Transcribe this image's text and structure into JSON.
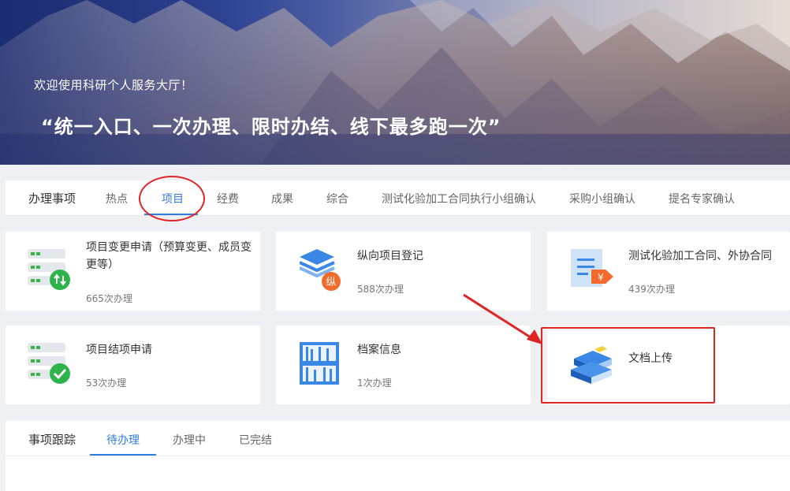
{
  "banner": {
    "welcome": "欢迎使用科研个人服务大厅！",
    "slogan": "“统一入口、一次办理、限时办结、线下最多跑一次”"
  },
  "tabs": {
    "title": "办理事项",
    "items": [
      "热点",
      "项目",
      "经费",
      "成果",
      "综合",
      "测试化验加工合同执行小组确认",
      "采购小组确认",
      "提名专家确认"
    ],
    "active": "项目"
  },
  "cards": [
    {
      "title_line1": "项目变更申请（预算变更、成员变",
      "title_line2": "更等）",
      "count": "665次办理",
      "icon": "server-update-icon"
    },
    {
      "title_line1": "纵向项目登记",
      "count": "588次办理",
      "icon": "layers-badge-icon",
      "badge": "纵"
    },
    {
      "title_line1": "测试化验加工合同、外协合同",
      "count": "439次办理",
      "icon": "document-yuan-icon",
      "badge": "¥"
    },
    {
      "title_line1": "项目结项申请",
      "count": "53次办理",
      "icon": "server-check-icon"
    },
    {
      "title_line1": "档案信息",
      "count": "1次办理",
      "icon": "archive-shelf-icon"
    },
    {
      "title_line1": "文档上传",
      "icon": "books-icon"
    }
  ],
  "tracking": {
    "title": "事项跟踪",
    "tabs": [
      "待办理",
      "办理中",
      "已完结"
    ],
    "active": "待办理"
  },
  "colors": {
    "accent": "#2f7de1",
    "annotation": "#e02424",
    "green": "#2db34a",
    "orange": "#f26b2d"
  }
}
